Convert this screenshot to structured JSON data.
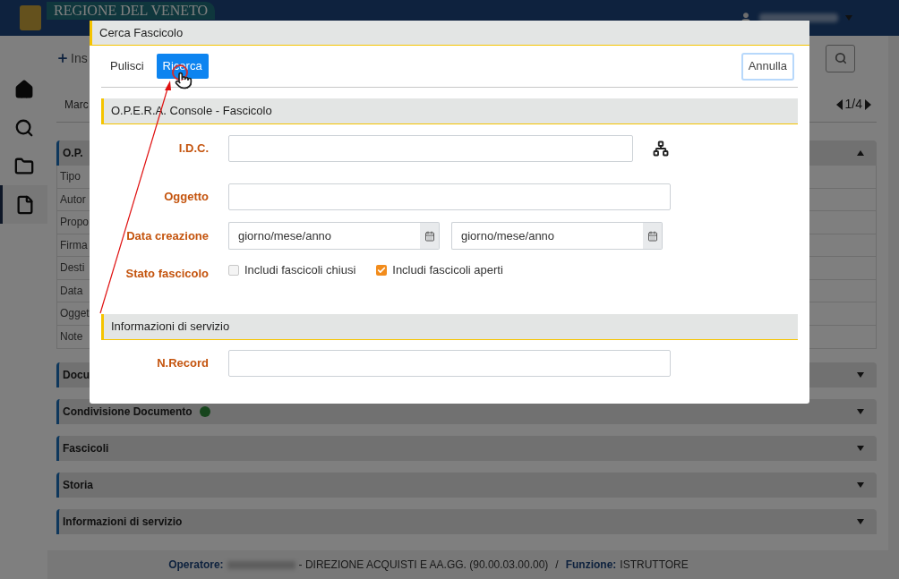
{
  "app_header": {
    "logo_text": "REGIONE DEL VENETO"
  },
  "sidebar": {
    "items": [
      {
        "kind": "home",
        "selected": false
      },
      {
        "kind": "search",
        "selected": false
      },
      {
        "kind": "folder",
        "selected": false
      },
      {
        "kind": "document",
        "selected": true
      }
    ]
  },
  "toolbar": {
    "insert_label": "Ins",
    "pager": "1/4"
  },
  "tab_label": "Marc",
  "panels": [
    {
      "title": "O.P.",
      "expanded": true,
      "rows": [
        "Tipo",
        "Autor",
        "Propo",
        "Firma",
        "Desti",
        "Data",
        "Ogget",
        "Note"
      ]
    },
    {
      "title": "Docu",
      "expanded": false
    },
    {
      "title": "Condivisione Documento",
      "expanded": false,
      "badge": true
    },
    {
      "title": "Fascicoli",
      "expanded": false
    },
    {
      "title": "Storia",
      "expanded": false
    },
    {
      "title": "Informazioni di servizio",
      "expanded": false
    }
  ],
  "status_bar": {
    "operator_label": "Operatore:",
    "department": "- DIREZIONE ACQUISTI E AA.GG. (90.00.03.00.00)",
    "separator": "/",
    "function_label": "Funzione:",
    "function": "ISTRUTTORE"
  },
  "dialog": {
    "title": "Cerca Fascicolo",
    "buttons": [
      {
        "label": "Pulisci",
        "kind": "plain"
      },
      {
        "label": "Ricerca",
        "kind": "primary"
      },
      {
        "label": "Annulla",
        "kind": "outline"
      }
    ],
    "sections": [
      {
        "title": "O.P.E.R.A. Console - Fascicolo",
        "fields": [
          {
            "kind": "lookup",
            "label": "I.D.C."
          },
          {
            "kind": "text",
            "label": "Oggetto"
          },
          {
            "kind": "daterange",
            "label": "Data creazione",
            "placeholders": [
              "giorno/mese/anno",
              "giorno/mese/anno"
            ]
          },
          {
            "kind": "checks",
            "label": "Stato fascicolo",
            "options": [
              {
                "label": "Includi fascicoli chiusi",
                "checked": false
              },
              {
                "label": "Includi fascicoli aperti",
                "checked": true
              }
            ]
          }
        ]
      },
      {
        "title": "Informazioni di servizio",
        "fields": [
          {
            "kind": "text",
            "label": "N.Record"
          }
        ]
      }
    ]
  }
}
